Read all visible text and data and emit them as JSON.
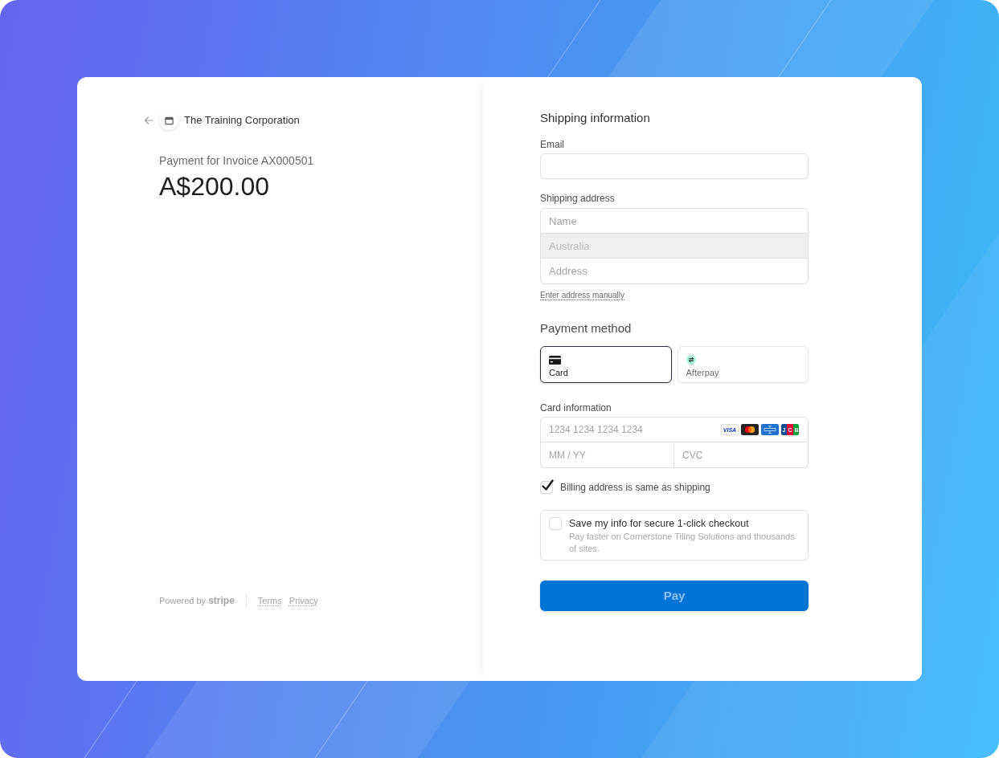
{
  "merchant": {
    "name": "The Training Corporation"
  },
  "summary": {
    "description": "Payment for Invoice AX000501",
    "amount": "A$200.00"
  },
  "footer": {
    "powered_by": "Powered by **stripe**",
    "links": [
      "Terms",
      "Privacy"
    ]
  },
  "shipping": {
    "title": "Shipping information",
    "email": {
      "label": "Email"
    },
    "address": {
      "label": "Shipping address",
      "fields": [
        {
          "placeholder": "Name",
          "disabled": false
        },
        {
          "value": "Australia",
          "disabled": true
        },
        {
          "placeholder": "Address",
          "disabled": false
        }
      ],
      "manual_link": "Enter address manually"
    }
  },
  "payment": {
    "title": "Payment method",
    "methods": [
      {
        "kind": "card",
        "label": "Card",
        "selected": true
      },
      {
        "kind": "afterpay",
        "label": "Afterpay",
        "selected": false
      }
    ]
  },
  "card_info": {
    "label": "Card information",
    "number": {
      "placeholder": "1234 1234 1234 1234"
    },
    "brands": [
      {
        "kind": "visa",
        "label": "VISA"
      },
      {
        "kind": "mastercard"
      },
      {
        "kind": "amex"
      },
      {
        "kind": "jcb",
        "label": "JCB"
      }
    ],
    "expiry": {
      "placeholder": "MM / YY"
    },
    "cvc": {
      "placeholder": "CVC"
    }
  },
  "billing_same": {
    "label": "Billing address is same as shipping",
    "checked": true
  },
  "save_info": {
    "label": "Save my info for secure 1-click checkout",
    "description": "Pay faster on Cornerstone Tiling Solutions and thousands of sites.",
    "checked": false
  },
  "pay_button": {
    "label": "Pay",
    "disabled": true
  }
}
